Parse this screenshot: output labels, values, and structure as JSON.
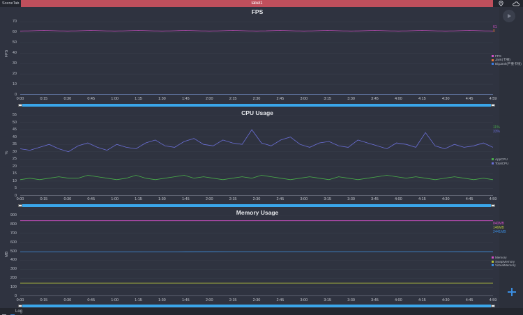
{
  "topbar": {
    "scene_tab": "SceneTab",
    "label": "label1",
    "icons": [
      "location-icon",
      "cloud-icon"
    ]
  },
  "colors": {
    "fps": "#d34fc8",
    "jank": "#e8783a",
    "bigjank": "#3a7ee8",
    "app_cpu": "#49b04a",
    "total_cpu": "#6b6fd8",
    "memory": "#d34fc8",
    "swap": "#b2c23c",
    "virtual": "#3a8de0",
    "scroll": "#3aa6ea"
  },
  "x_ticks": [
    "0:00",
    "0:15",
    "0:30",
    "0:45",
    "1:00",
    "1:15",
    "1:30",
    "1:45",
    "2:00",
    "2:15",
    "2:30",
    "2:45",
    "3:00",
    "3:15",
    "3:30",
    "3:45",
    "4:00",
    "4:15",
    "4:30",
    "4:45",
    "4:59"
  ],
  "charts": {
    "fps": {
      "title": "FPS",
      "ylabel": "FPS",
      "y_ticks": [
        "70",
        "60",
        "50",
        "40",
        "30",
        "20",
        "10",
        "0"
      ],
      "legend": [
        "FPS",
        "Jank(卡顿)",
        "BigJank(严重卡顿)"
      ],
      "current_values": [
        "61",
        "0"
      ]
    },
    "cpu": {
      "title": "CPU Usage",
      "ylabel": "%",
      "y_ticks": [
        "55",
        "50",
        "45",
        "40",
        "35",
        "30",
        "25",
        "20",
        "15",
        "10",
        "5",
        "0"
      ],
      "legend": [
        "AppCPU",
        "TotalCPU"
      ],
      "current_values": [
        "11%",
        "33%"
      ]
    },
    "memory": {
      "title": "Memory Usage",
      "ylabel": "MB",
      "y_ticks": [
        "900",
        "800",
        "700",
        "600",
        "500",
        "400",
        "300",
        "200",
        "100",
        "0"
      ],
      "legend": [
        "Memory",
        "SwapMemory",
        "VirtualMemory"
      ],
      "current_values": [
        "840MB",
        "146MB",
        "2441MB"
      ]
    }
  },
  "bottombar": {
    "log_label": "Log"
  },
  "chart_data": [
    {
      "type": "line",
      "title": "FPS",
      "ylabel": "FPS",
      "ylim": [
        0,
        75
      ],
      "x_range": [
        "0:00",
        "4:59"
      ],
      "series": [
        {
          "name": "FPS",
          "values": [
            61,
            62,
            61,
            62,
            61,
            62,
            61,
            62,
            61,
            62,
            61,
            62,
            61,
            62,
            61,
            62,
            61,
            62,
            61,
            62,
            61
          ]
        },
        {
          "name": "Jank(卡顿)",
          "values": [
            0,
            0,
            0,
            0,
            0,
            0,
            0,
            0,
            0,
            0,
            0,
            0,
            0,
            0,
            0,
            0,
            0,
            0,
            0,
            0,
            0
          ]
        },
        {
          "name": "BigJank(严重卡顿)",
          "values": [
            0,
            0,
            0,
            0,
            0,
            0,
            0,
            0,
            0,
            0,
            0,
            0,
            0,
            0,
            0,
            0,
            0,
            0,
            0,
            0,
            0
          ]
        }
      ]
    },
    {
      "type": "line",
      "title": "CPU Usage",
      "ylabel": "%",
      "ylim": [
        0,
        55
      ],
      "x_range": [
        "0:00",
        "4:59"
      ],
      "series": [
        {
          "name": "AppCPU",
          "values": [
            11,
            12,
            11,
            12,
            13,
            12,
            12,
            14,
            13,
            12,
            11,
            12,
            14,
            12,
            11,
            12,
            13,
            14,
            12,
            13,
            12,
            11,
            12,
            13,
            12,
            14,
            13,
            12,
            11,
            12,
            13,
            12,
            11,
            13,
            12,
            11,
            12,
            13,
            14,
            13,
            12,
            13,
            12,
            11,
            12,
            13,
            12,
            11,
            12,
            11
          ]
        },
        {
          "name": "TotalCPU",
          "values": [
            32,
            31,
            33,
            35,
            32,
            30,
            34,
            36,
            33,
            31,
            35,
            33,
            32,
            36,
            38,
            34,
            33,
            37,
            39,
            35,
            34,
            38,
            36,
            35,
            45,
            36,
            34,
            38,
            40,
            35,
            33,
            36,
            37,
            34,
            33,
            38,
            36,
            34,
            32,
            36,
            35,
            33,
            43,
            34,
            32,
            35,
            33,
            34,
            36,
            33
          ]
        }
      ]
    },
    {
      "type": "line",
      "title": "Memory Usage",
      "ylabel": "MB",
      "ylim": [
        0,
        900
      ],
      "x_range": [
        "0:00",
        "4:59"
      ],
      "series": [
        {
          "name": "Memory",
          "values": [
            840,
            840,
            840,
            840,
            840,
            840,
            840,
            840,
            840,
            840,
            840,
            840,
            840,
            840,
            840,
            840,
            840,
            840,
            840,
            840,
            840
          ]
        },
        {
          "name": "SwapMemory",
          "values": [
            146,
            146,
            146,
            146,
            146,
            146,
            146,
            146,
            146,
            146,
            146,
            146,
            146,
            146,
            146,
            146,
            146,
            146,
            146,
            146,
            146
          ]
        },
        {
          "name": "VirtualMemory",
          "values": [
            492,
            492,
            492,
            492,
            492,
            492,
            493,
            494,
            495,
            496,
            496,
            496,
            496,
            496,
            496,
            496,
            496,
            496,
            496,
            495,
            495
          ]
        }
      ]
    }
  ]
}
